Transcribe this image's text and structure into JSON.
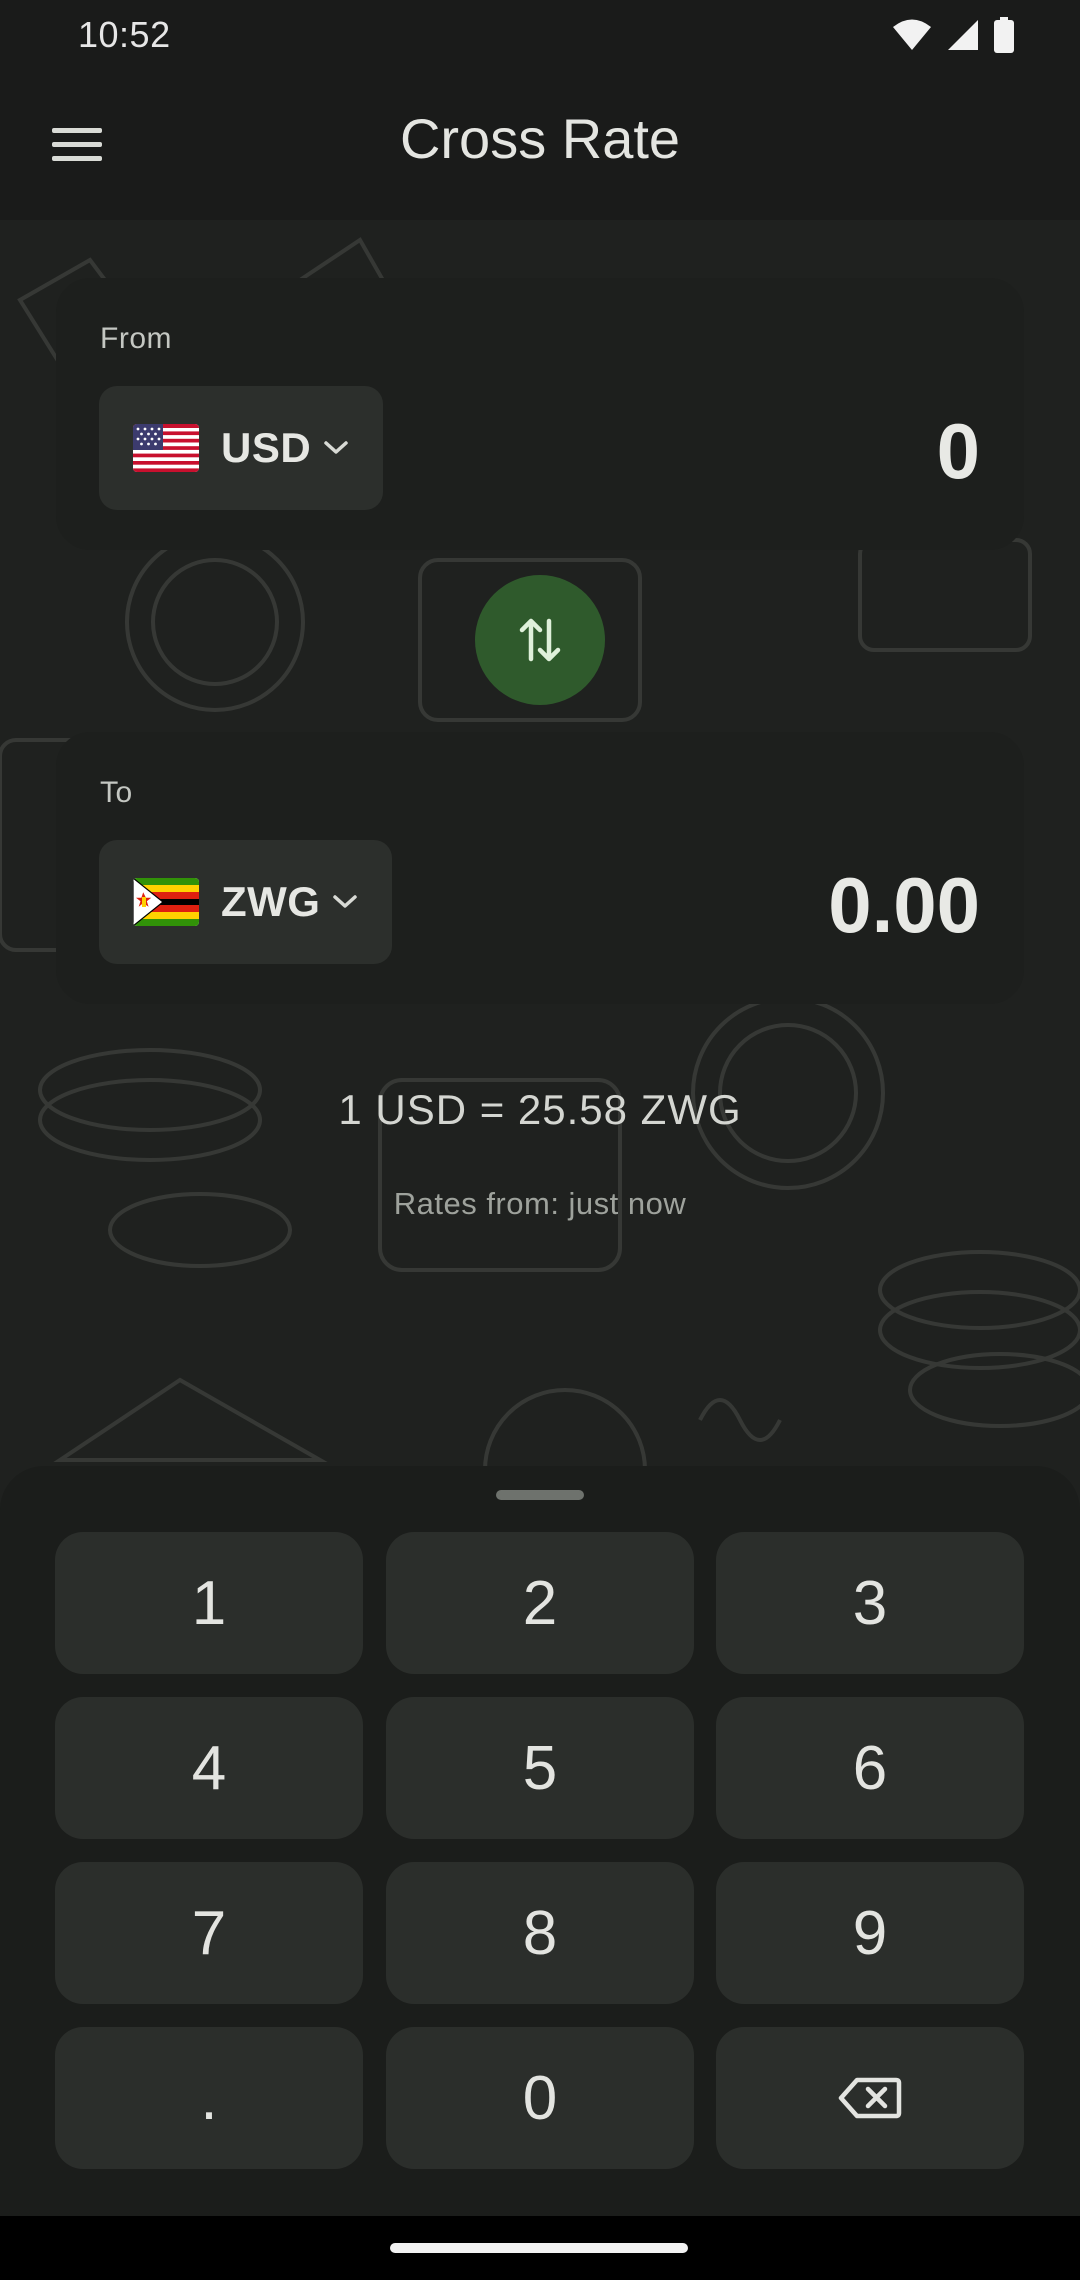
{
  "status_bar": {
    "time": "10:52",
    "icons": [
      "wifi-icon",
      "cellular-signal-icon",
      "battery-icon"
    ]
  },
  "app_bar": {
    "title": "Cross Rate",
    "menu_icon": "hamburger-menu-icon"
  },
  "from_card": {
    "label": "From",
    "currency_code": "USD",
    "flag": "us-flag",
    "amount": "0"
  },
  "swap": {
    "icon": "swap-vertical-icon",
    "color": "#2f5a2c"
  },
  "to_card": {
    "label": "To",
    "currency_code": "ZWG",
    "flag": "zimbabwe-flag",
    "amount": "0.00"
  },
  "rate": {
    "text": "1 USD = 25.58 ZWG",
    "updated": "Rates from: just now"
  },
  "keypad": {
    "keys": [
      [
        "1",
        "2",
        "3"
      ],
      [
        "4",
        "5",
        "6"
      ],
      [
        "7",
        "8",
        "9"
      ],
      [
        ".",
        "0",
        ""
      ]
    ],
    "backspace_icon": "backspace-icon"
  },
  "colors": {
    "background": "#1f211f",
    "card": "#1d1f1d",
    "key": "#2b2e2b",
    "accent": "#2f5a2c"
  }
}
